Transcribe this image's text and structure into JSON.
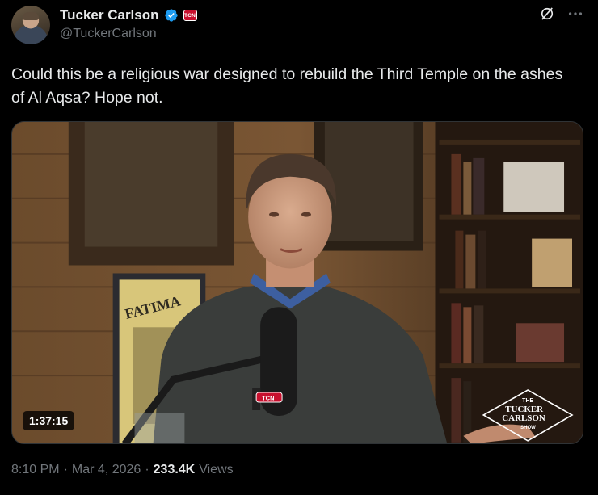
{
  "author": {
    "display_name": "Tucker Carlson",
    "handle": "@TuckerCarlson",
    "affiliate_badge_text": "TCN"
  },
  "tweet": {
    "text": "Could this be a religious war designed to rebuild the Third Temple on the ashes of Al Aqsa? Hope not.",
    "video_duration": "1:37:15",
    "video_overlay": {
      "poster_word": "FATIMA",
      "mic_badge": "TCN",
      "show_logo_top": "THE",
      "show_logo_main_1": "TUCKER",
      "show_logo_main_2": "CARLSON",
      "show_logo_bottom": "SHOW"
    }
  },
  "meta": {
    "time": "8:10 PM",
    "dot1": "·",
    "date": "Mar 4, 2026",
    "dot2": "·",
    "views_count": "233.4K",
    "views_label": "Views"
  },
  "colors": {
    "background": "#000000",
    "text_primary": "#e7e9ea",
    "text_secondary": "#71767b",
    "verified_blue": "#1d9bf0",
    "badge_red": "#c8102e"
  }
}
